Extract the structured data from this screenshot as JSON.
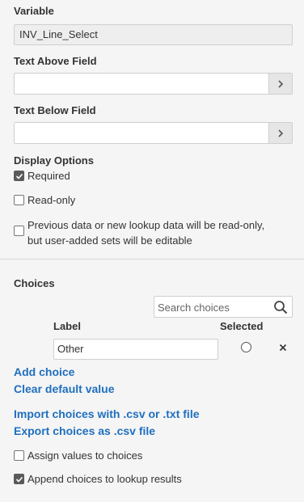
{
  "variable": {
    "label": "Variable",
    "value": "INV_Line_Select"
  },
  "text_above": {
    "label": "Text Above Field",
    "value": ""
  },
  "text_below": {
    "label": "Text Below Field",
    "value": ""
  },
  "display_options": {
    "label": "Display Options",
    "required": {
      "label": "Required",
      "checked": true
    },
    "read_only": {
      "label": "Read-only",
      "checked": false
    },
    "prev_data": {
      "label_line1": "Previous data or new lookup data will be read-only,",
      "label_line2": "but user-added sets will be editable",
      "checked": false
    }
  },
  "choices": {
    "label": "Choices",
    "search_placeholder": "Search choices",
    "columns": {
      "label": "Label",
      "selected": "Selected"
    },
    "rows": [
      {
        "label": "Other",
        "selected": false
      }
    ],
    "add_choice": "Add choice",
    "clear_default": "Clear default value",
    "import": "Import choices with .csv or .txt file",
    "export": "Export choices as .csv file",
    "assign_values": {
      "label": "Assign values to choices",
      "checked": false
    },
    "append_lookup": {
      "label": "Append choices to lookup results",
      "checked": true
    }
  },
  "icons": {
    "chevron": "chevron-right-icon",
    "search": "search-icon",
    "remove": "close-icon"
  }
}
